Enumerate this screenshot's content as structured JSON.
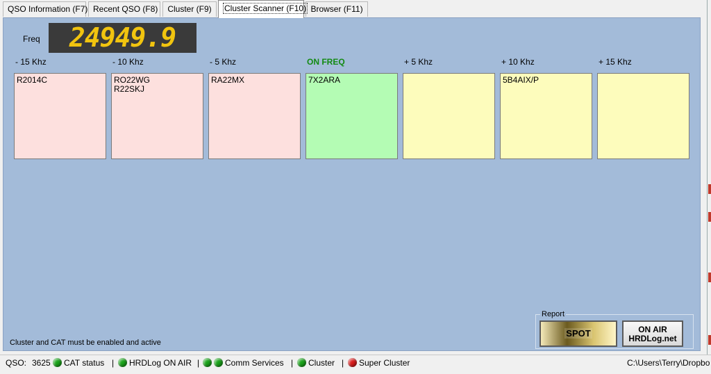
{
  "tabs": [
    {
      "label": "QSO Information (F7)",
      "active": false
    },
    {
      "label": "Recent QSO (F8)",
      "active": false
    },
    {
      "label": "Cluster (F9)",
      "active": false
    },
    {
      "label": "Cluster Scanner (F10)",
      "active": true
    },
    {
      "label": "Browser (F11)",
      "active": false
    }
  ],
  "freq": {
    "label": "Freq",
    "value": "24949.9"
  },
  "columns": [
    {
      "label": "- 15 Khz",
      "calls": "R2014C",
      "state": "red"
    },
    {
      "label": "- 10 Khz",
      "calls": "RO22WG\nR22SKJ",
      "state": "red"
    },
    {
      "label": "- 5 Khz",
      "calls": "RA22MX",
      "state": "red"
    },
    {
      "label": "ON FREQ",
      "calls": "7X2ARA",
      "state": "green"
    },
    {
      "label": "+ 5 Khz",
      "calls": "",
      "state": "yellow"
    },
    {
      "label": "+ 10 Khz",
      "calls": "5B4AIX/P",
      "state": "yellow"
    },
    {
      "label": "+ 15 Khz",
      "calls": "",
      "state": "yellow"
    }
  ],
  "hint": "Cluster and CAT must be enabled and active",
  "report": {
    "label": "Report",
    "spot_label": "SPOT",
    "onair_line1": "ON AIR",
    "onair_line2": "HRDLog.net"
  },
  "status": {
    "qso_label": "QSO:",
    "qso_count": "3625",
    "cat": "CAT status",
    "hrdlog": "HRDLog ON AIR",
    "comm": "Comm Services",
    "cluster": "Cluster",
    "super_cluster": "Super Cluster",
    "path": "C:\\Users\\Terry\\Dropbo"
  },
  "colors": {
    "panel": "#a3bbd9",
    "led_ok": "#1aa31a",
    "led_bad": "#d81c1c",
    "freq_digits": "#f1c40f"
  }
}
